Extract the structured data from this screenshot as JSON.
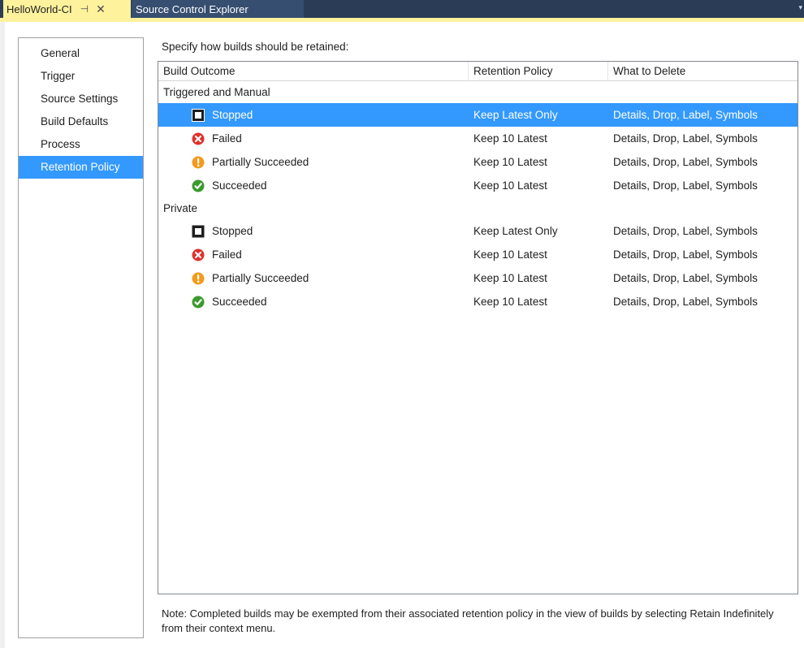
{
  "tabs": {
    "active": {
      "title": "HelloWorld-CI",
      "pin_glyph": "⊣",
      "close_glyph": "✕"
    },
    "inactive": {
      "title": "Source Control Explorer"
    },
    "overflow_glyph": "▾"
  },
  "nav": {
    "items": [
      {
        "label": "General"
      },
      {
        "label": "Trigger"
      },
      {
        "label": "Source Settings"
      },
      {
        "label": "Build Defaults"
      },
      {
        "label": "Process"
      },
      {
        "label": "Retention Policy",
        "selected": true
      }
    ]
  },
  "instruction": "Specify how builds should be retained:",
  "grid": {
    "columns": [
      "Build Outcome",
      "Retention Policy",
      "What to Delete"
    ],
    "groups": [
      {
        "label": "Triggered and Manual",
        "rows": [
          {
            "outcome": "Stopped",
            "icon": "stopped-icon",
            "policy": "Keep Latest Only",
            "delete": "Details, Drop, Label, Symbols",
            "selected": true
          },
          {
            "outcome": "Failed",
            "icon": "failed-icon",
            "policy": "Keep 10 Latest",
            "delete": "Details, Drop, Label, Symbols"
          },
          {
            "outcome": "Partially Succeeded",
            "icon": "partially-succeeded-icon",
            "policy": "Keep 10 Latest",
            "delete": "Details, Drop, Label, Symbols"
          },
          {
            "outcome": "Succeeded",
            "icon": "succeeded-icon",
            "policy": "Keep 10 Latest",
            "delete": "Details, Drop, Label, Symbols"
          }
        ]
      },
      {
        "label": "Private",
        "rows": [
          {
            "outcome": "Stopped",
            "icon": "stopped-icon",
            "policy": "Keep Latest Only",
            "delete": "Details, Drop, Label, Symbols"
          },
          {
            "outcome": "Failed",
            "icon": "failed-icon",
            "policy": "Keep 10 Latest",
            "delete": "Details, Drop, Label, Symbols"
          },
          {
            "outcome": "Partially Succeeded",
            "icon": "partially-succeeded-icon",
            "policy": "Keep 10 Latest",
            "delete": "Details, Drop, Label, Symbols"
          },
          {
            "outcome": "Succeeded",
            "icon": "succeeded-icon",
            "policy": "Keep 10 Latest",
            "delete": "Details, Drop, Label, Symbols"
          }
        ]
      }
    ]
  },
  "note": "Note: Completed builds may be exempted from their associated retention policy in the view of builds by selecting Retain Indefinitely from their context menu.",
  "colors": {
    "selection": "#3399ff",
    "active_tab": "#fff29d",
    "tabstrip": "#2b3c57",
    "failed": "#e0302c",
    "partial": "#f29b1d",
    "succeeded": "#3a9a2c"
  }
}
